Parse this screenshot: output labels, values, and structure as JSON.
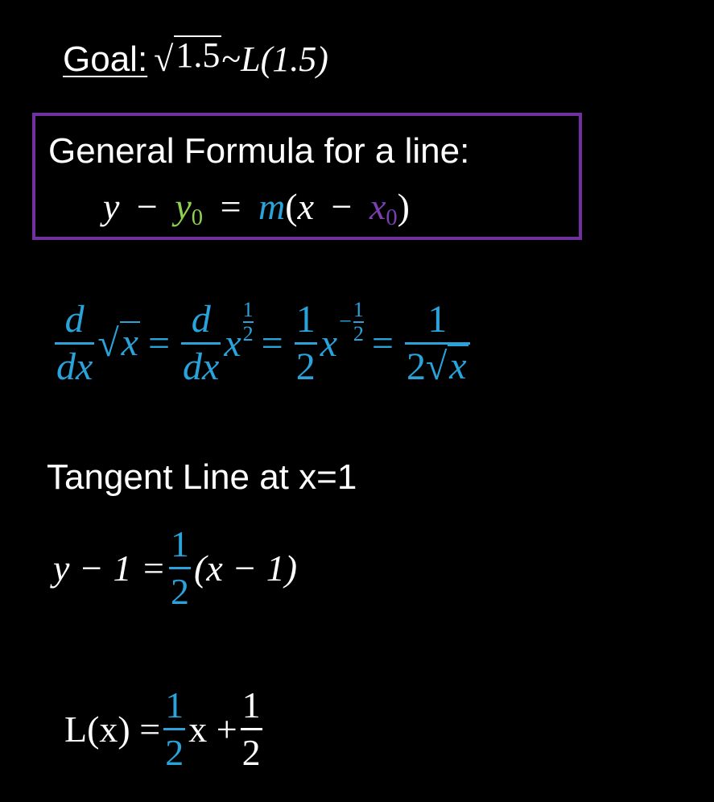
{
  "goal": {
    "label": "Goal:",
    "radicand": "1.5",
    "approx": "~",
    "rhs": "L(1.5)"
  },
  "box": {
    "title": "General Formula for a line:",
    "y": "y",
    "minus": "−",
    "y0": "y",
    "sub0": "0",
    "equals": "=",
    "m": "m",
    "x": "x",
    "x0": "x",
    "sub1": "0"
  },
  "derivative": {
    "d": "d",
    "dx": "dx",
    "x": "x",
    "equals": "=",
    "one": "1",
    "two": "2",
    "minus": "−",
    "den_two": "2"
  },
  "tangent": {
    "title": "Tangent Line at x=1",
    "lhs": "y − 1 =",
    "num": "1",
    "den": "2",
    "rhs": "(x − 1)"
  },
  "linearization": {
    "lhs": "L(x) =",
    "num1": "1",
    "den1": "2",
    "mid": "x +",
    "num2": "1",
    "den2": "2"
  },
  "colors": {
    "background": "#000000",
    "text": "#ffffff",
    "blue": "#29a3da",
    "green": "#8fd14f",
    "purple_box": "#7030a0",
    "purple_text": "#7b3fb0"
  }
}
